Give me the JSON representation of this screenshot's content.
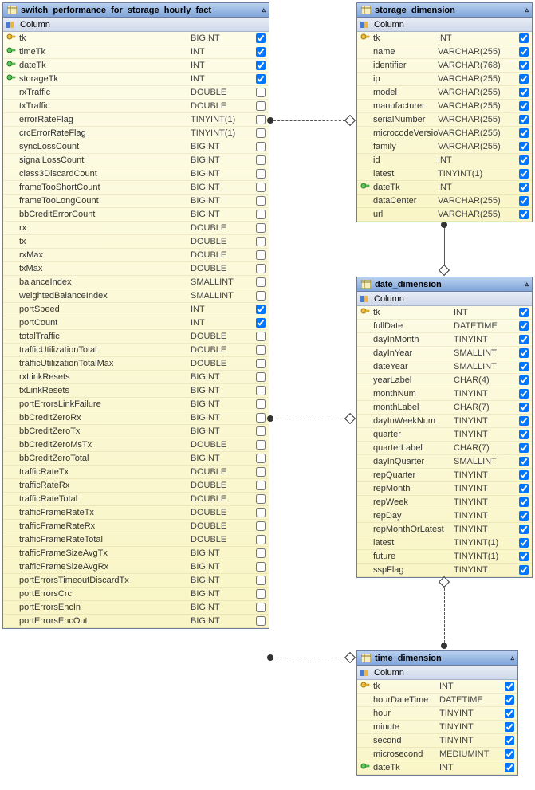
{
  "column_label": "Column",
  "tables": {
    "switch_perf": {
      "title": "switch_performance_for_storage_hourly_fact",
      "rows": [
        {
          "key": "pk",
          "name": "tk",
          "type": "BIGINT",
          "chk": true
        },
        {
          "key": "fk",
          "name": "timeTk",
          "type": "INT",
          "chk": true
        },
        {
          "key": "fk",
          "name": "dateTk",
          "type": "INT",
          "chk": true
        },
        {
          "key": "fk",
          "name": "storageTk",
          "type": "INT",
          "chk": true
        },
        {
          "key": "",
          "name": "rxTraffic",
          "type": "DOUBLE",
          "chk": false
        },
        {
          "key": "",
          "name": "txTraffic",
          "type": "DOUBLE",
          "chk": false
        },
        {
          "key": "",
          "name": "errorRateFlag",
          "type": "TINYINT(1)",
          "chk": false
        },
        {
          "key": "",
          "name": "crcErrorRateFlag",
          "type": "TINYINT(1)",
          "chk": false
        },
        {
          "key": "",
          "name": "syncLossCount",
          "type": "BIGINT",
          "chk": false
        },
        {
          "key": "",
          "name": "signalLossCount",
          "type": "BIGINT",
          "chk": false
        },
        {
          "key": "",
          "name": "class3DiscardCount",
          "type": "BIGINT",
          "chk": false
        },
        {
          "key": "",
          "name": "frameTooShortCount",
          "type": "BIGINT",
          "chk": false
        },
        {
          "key": "",
          "name": "frameTooLongCount",
          "type": "BIGINT",
          "chk": false
        },
        {
          "key": "",
          "name": "bbCreditErrorCount",
          "type": "BIGINT",
          "chk": false
        },
        {
          "key": "",
          "name": "rx",
          "type": "DOUBLE",
          "chk": false
        },
        {
          "key": "",
          "name": "tx",
          "type": "DOUBLE",
          "chk": false
        },
        {
          "key": "",
          "name": "rxMax",
          "type": "DOUBLE",
          "chk": false
        },
        {
          "key": "",
          "name": "txMax",
          "type": "DOUBLE",
          "chk": false
        },
        {
          "key": "",
          "name": "balanceIndex",
          "type": "SMALLINT",
          "chk": false
        },
        {
          "key": "",
          "name": "weightedBalanceIndex",
          "type": "SMALLINT",
          "chk": false
        },
        {
          "key": "",
          "name": "portSpeed",
          "type": "INT",
          "chk": true
        },
        {
          "key": "",
          "name": "portCount",
          "type": "INT",
          "chk": true
        },
        {
          "key": "",
          "name": "totalTraffic",
          "type": "DOUBLE",
          "chk": false
        },
        {
          "key": "",
          "name": "trafficUtilizationTotal",
          "type": "DOUBLE",
          "chk": false
        },
        {
          "key": "",
          "name": "trafficUtilizationTotalMax",
          "type": "DOUBLE",
          "chk": false
        },
        {
          "key": "",
          "name": "rxLinkResets",
          "type": "BIGINT",
          "chk": false
        },
        {
          "key": "",
          "name": "txLinkResets",
          "type": "BIGINT",
          "chk": false
        },
        {
          "key": "",
          "name": "portErrorsLinkFailure",
          "type": "BIGINT",
          "chk": false
        },
        {
          "key": "",
          "name": "bbCreditZeroRx",
          "type": "BIGINT",
          "chk": false
        },
        {
          "key": "",
          "name": "bbCreditZeroTx",
          "type": "BIGINT",
          "chk": false
        },
        {
          "key": "",
          "name": "bbCreditZeroMsTx",
          "type": "DOUBLE",
          "chk": false
        },
        {
          "key": "",
          "name": "bbCreditZeroTotal",
          "type": "BIGINT",
          "chk": false
        },
        {
          "key": "",
          "name": "trafficRateTx",
          "type": "DOUBLE",
          "chk": false
        },
        {
          "key": "",
          "name": "trafficRateRx",
          "type": "DOUBLE",
          "chk": false
        },
        {
          "key": "",
          "name": "trafficRateTotal",
          "type": "DOUBLE",
          "chk": false
        },
        {
          "key": "",
          "name": "trafficFrameRateTx",
          "type": "DOUBLE",
          "chk": false
        },
        {
          "key": "",
          "name": "trafficFrameRateRx",
          "type": "DOUBLE",
          "chk": false
        },
        {
          "key": "",
          "name": "trafficFrameRateTotal",
          "type": "DOUBLE",
          "chk": false
        },
        {
          "key": "",
          "name": "trafficFrameSizeAvgTx",
          "type": "BIGINT",
          "chk": false
        },
        {
          "key": "",
          "name": "trafficFrameSizeAvgRx",
          "type": "BIGINT",
          "chk": false
        },
        {
          "key": "",
          "name": "portErrorsTimeoutDiscardTx",
          "type": "BIGINT",
          "chk": false
        },
        {
          "key": "",
          "name": "portErrorsCrc",
          "type": "BIGINT",
          "chk": false
        },
        {
          "key": "",
          "name": "portErrorsEncIn",
          "type": "BIGINT",
          "chk": false
        },
        {
          "key": "",
          "name": "portErrorsEncOut",
          "type": "BIGINT",
          "chk": false
        }
      ]
    },
    "storage_dim": {
      "title": "storage_dimension",
      "rows": [
        {
          "key": "pk",
          "name": "tk",
          "type": "INT",
          "chk": true
        },
        {
          "key": "",
          "name": "name",
          "type": "VARCHAR(255)",
          "chk": true
        },
        {
          "key": "",
          "name": "identifier",
          "type": "VARCHAR(768)",
          "chk": true
        },
        {
          "key": "",
          "name": "ip",
          "type": "VARCHAR(255)",
          "chk": true
        },
        {
          "key": "",
          "name": "model",
          "type": "VARCHAR(255)",
          "chk": true
        },
        {
          "key": "",
          "name": "manufacturer",
          "type": "VARCHAR(255)",
          "chk": true
        },
        {
          "key": "",
          "name": "serialNumber",
          "type": "VARCHAR(255)",
          "chk": true
        },
        {
          "key": "",
          "name": "microcodeVersion",
          "type": "VARCHAR(255)",
          "chk": true
        },
        {
          "key": "",
          "name": "family",
          "type": "VARCHAR(255)",
          "chk": true
        },
        {
          "key": "",
          "name": "id",
          "type": "INT",
          "chk": true
        },
        {
          "key": "",
          "name": "latest",
          "type": "TINYINT(1)",
          "chk": true
        },
        {
          "key": "fk",
          "name": "dateTk",
          "type": "INT",
          "chk": true
        },
        {
          "key": "",
          "name": "dataCenter",
          "type": "VARCHAR(255)",
          "chk": true
        },
        {
          "key": "",
          "name": "url",
          "type": "VARCHAR(255)",
          "chk": true
        }
      ]
    },
    "date_dim": {
      "title": "date_dimension",
      "rows": [
        {
          "key": "pk",
          "name": "tk",
          "type": "INT",
          "chk": true
        },
        {
          "key": "",
          "name": "fullDate",
          "type": "DATETIME",
          "chk": true
        },
        {
          "key": "",
          "name": "dayInMonth",
          "type": "TINYINT",
          "chk": true
        },
        {
          "key": "",
          "name": "dayInYear",
          "type": "SMALLINT",
          "chk": true
        },
        {
          "key": "",
          "name": "dateYear",
          "type": "SMALLINT",
          "chk": true
        },
        {
          "key": "",
          "name": "yearLabel",
          "type": "CHAR(4)",
          "chk": true
        },
        {
          "key": "",
          "name": "monthNum",
          "type": "TINYINT",
          "chk": true
        },
        {
          "key": "",
          "name": "monthLabel",
          "type": "CHAR(7)",
          "chk": true
        },
        {
          "key": "",
          "name": "dayInWeekNum",
          "type": "TINYINT",
          "chk": true
        },
        {
          "key": "",
          "name": "quarter",
          "type": "TINYINT",
          "chk": true
        },
        {
          "key": "",
          "name": "quarterLabel",
          "type": "CHAR(7)",
          "chk": true
        },
        {
          "key": "",
          "name": "dayInQuarter",
          "type": "SMALLINT",
          "chk": true
        },
        {
          "key": "",
          "name": "repQuarter",
          "type": "TINYINT",
          "chk": true
        },
        {
          "key": "",
          "name": "repMonth",
          "type": "TINYINT",
          "chk": true
        },
        {
          "key": "",
          "name": "repWeek",
          "type": "TINYINT",
          "chk": true
        },
        {
          "key": "",
          "name": "repDay",
          "type": "TINYINT",
          "chk": true
        },
        {
          "key": "",
          "name": "repMonthOrLatest",
          "type": "TINYINT",
          "chk": true
        },
        {
          "key": "",
          "name": "latest",
          "type": "TINYINT(1)",
          "chk": true
        },
        {
          "key": "",
          "name": "future",
          "type": "TINYINT(1)",
          "chk": true
        },
        {
          "key": "",
          "name": "sspFlag",
          "type": "TINYINT",
          "chk": true
        }
      ]
    },
    "time_dim": {
      "title": "time_dimension",
      "rows": [
        {
          "key": "pk",
          "name": "tk",
          "type": "INT",
          "chk": true
        },
        {
          "key": "",
          "name": "hourDateTime",
          "type": "DATETIME",
          "chk": true
        },
        {
          "key": "",
          "name": "hour",
          "type": "TINYINT",
          "chk": true
        },
        {
          "key": "",
          "name": "minute",
          "type": "TINYINT",
          "chk": true
        },
        {
          "key": "",
          "name": "second",
          "type": "TINYINT",
          "chk": true
        },
        {
          "key": "",
          "name": "microsecond",
          "type": "MEDIUMINT",
          "chk": true
        },
        {
          "key": "fk",
          "name": "dateTk",
          "type": "INT",
          "chk": true
        }
      ]
    }
  }
}
